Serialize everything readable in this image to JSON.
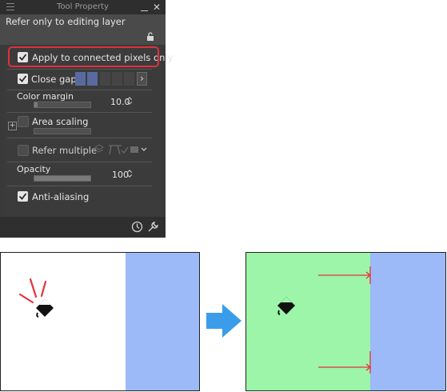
{
  "panel": {
    "title": "Tool Property",
    "preset_label": "Refer only to editing layer",
    "close_symbol": "✕"
  },
  "properties": {
    "apply_connected": {
      "label": "Apply to connected pixels only",
      "checked": true
    },
    "close_gap": {
      "label": "Close gap",
      "checked": true,
      "expand_symbol": "›"
    },
    "color_margin": {
      "label": "Color margin",
      "value": "10.0",
      "level": 0.03
    },
    "area_scaling": {
      "label": "Area scaling",
      "checked": false,
      "expand_symbol": "+"
    },
    "refer_multiple": {
      "label": "Refer multiple",
      "checked": false
    },
    "opacity": {
      "label": "Opacity",
      "value": "100",
      "level": 1.0
    },
    "anti_aliasing": {
      "label": "Anti-aliasing",
      "checked": true
    }
  },
  "colors": {
    "highlight": "#e0303f",
    "panel_bg": "#3a3a3a",
    "fill_green": "#9cf5a8",
    "layer_blue": "#9cbaf7",
    "arrow_blue": "#3b9de9",
    "arrow_red": "#e8303c"
  },
  "icons": [
    "menu-icon",
    "minimize-icon",
    "close-icon",
    "lock-icon",
    "spin-arrows-icon",
    "expand-icon",
    "layer-stack-icon",
    "dropdown-chevron-icon",
    "clock-icon",
    "wrench-icon",
    "fill-bucket-icon",
    "right-arrow-icon"
  ]
}
